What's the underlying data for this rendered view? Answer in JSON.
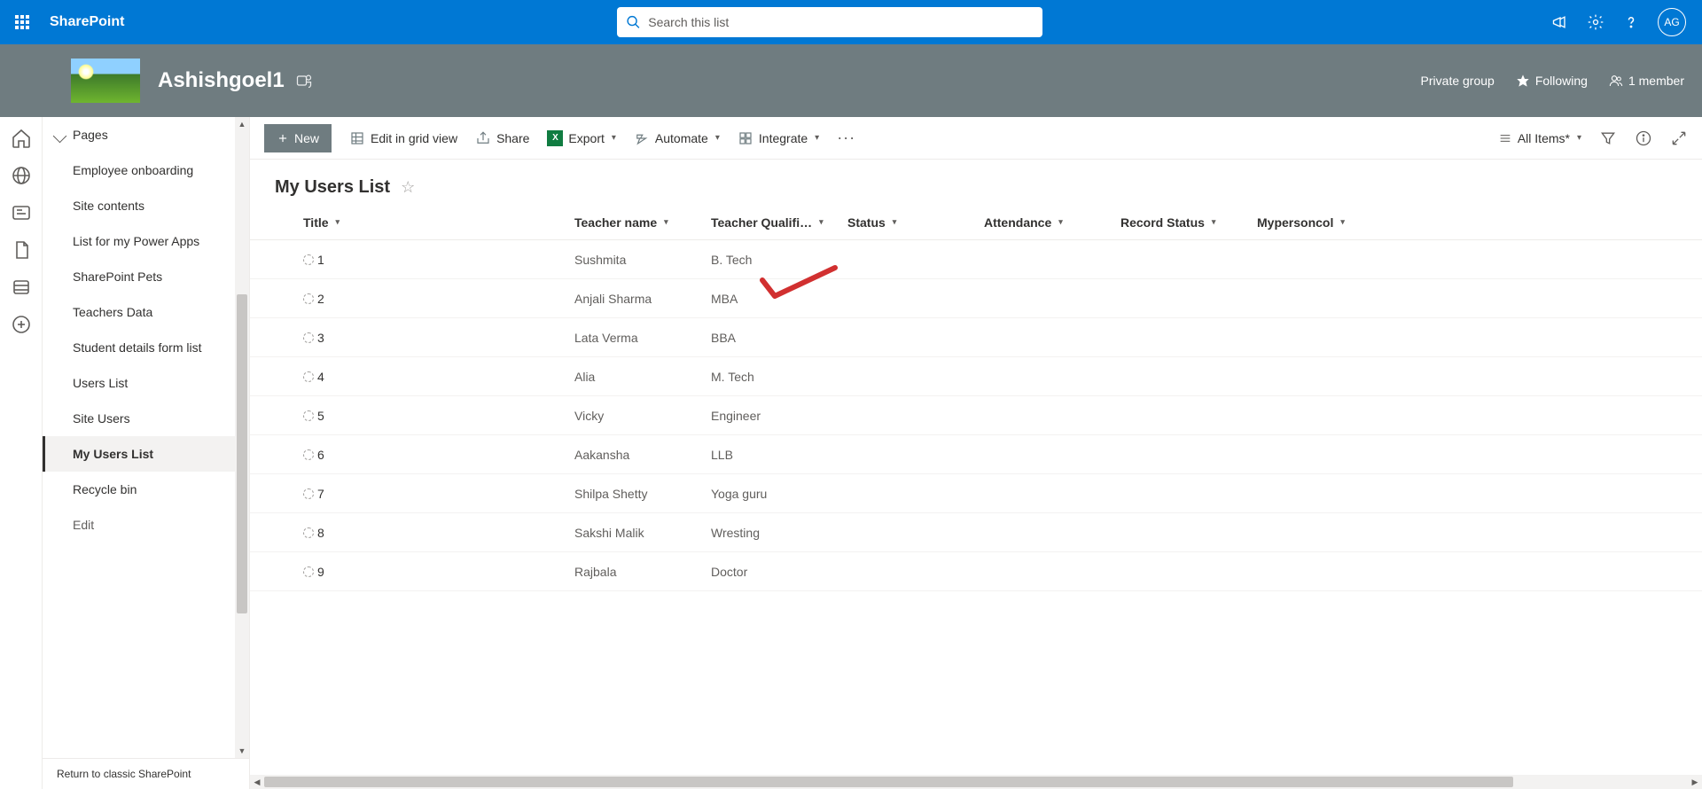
{
  "topbar": {
    "brand": "SharePoint",
    "search_placeholder": "Search this list",
    "avatar_initials": "AG"
  },
  "siteheader": {
    "site_name": "Ashishgoel1",
    "privacy": "Private group",
    "following": "Following",
    "members": "1 member"
  },
  "sidenav": {
    "items": [
      "Pages",
      "Employee onboarding",
      "Site contents",
      "List for my Power Apps",
      "SharePoint Pets",
      "Teachers Data",
      "Student details form list",
      "Users List",
      "Site Users",
      "My Users List",
      "Recycle bin",
      "Edit"
    ],
    "active_index": 9,
    "footer": "Return to classic SharePoint"
  },
  "cmdbar": {
    "new": "New",
    "edit_grid": "Edit in grid view",
    "share": "Share",
    "export": "Export",
    "automate": "Automate",
    "integrate": "Integrate",
    "view_label": "All Items*"
  },
  "list": {
    "title": "My Users List",
    "columns": [
      "Title",
      "Teacher name",
      "Teacher Qualifi…",
      "Status",
      "Attendance",
      "Record Status",
      "Mypersoncol"
    ],
    "rows": [
      {
        "title": "1",
        "teacher": "Sushmita",
        "qualif": "B. Tech"
      },
      {
        "title": "2",
        "teacher": "Anjali Sharma",
        "qualif": "MBA"
      },
      {
        "title": "3",
        "teacher": "Lata Verma",
        "qualif": "BBA"
      },
      {
        "title": "4",
        "teacher": "Alia",
        "qualif": "M. Tech"
      },
      {
        "title": "5",
        "teacher": "Vicky",
        "qualif": "Engineer"
      },
      {
        "title": "6",
        "teacher": "Aakansha",
        "qualif": "LLB"
      },
      {
        "title": "7",
        "teacher": "Shilpa Shetty",
        "qualif": "Yoga guru"
      },
      {
        "title": "8",
        "teacher": "Sakshi Malik",
        "qualif": "Wresting"
      },
      {
        "title": "9",
        "teacher": "Rajbala",
        "qualif": "Doctor"
      }
    ]
  }
}
